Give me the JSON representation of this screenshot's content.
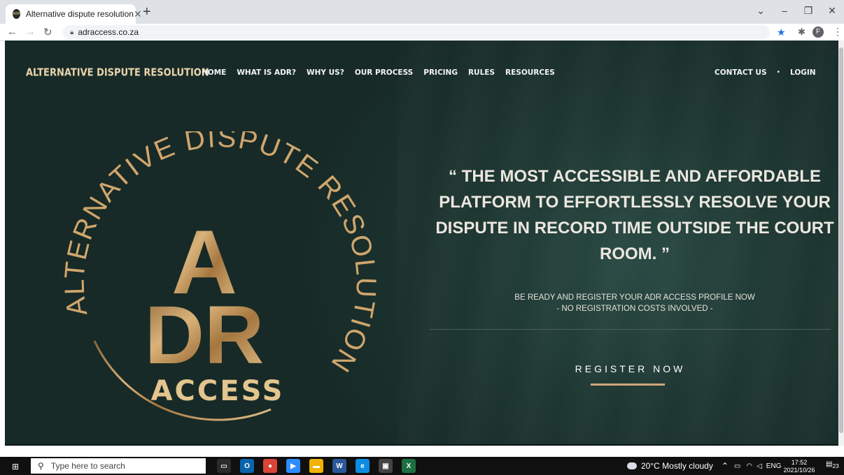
{
  "browser": {
    "tab_title": "Alternative dispute resolution",
    "tab_favicon": "ADR",
    "url": "adraccess.co.za",
    "profile_initial": "F",
    "window_controls": [
      "⌄",
      "–",
      "❐",
      "✕"
    ]
  },
  "site": {
    "brand": "ALTERNATIVE DISPUTE RESOLUTION",
    "nav_left": [
      "HOME",
      "WHAT IS ADR?",
      "WHY US?",
      "OUR PROCESS",
      "PRICING",
      "RULES",
      "RESOURCES"
    ],
    "nav_right": {
      "contact": "CONTACT US",
      "separator": "•",
      "login": "LOGIN"
    },
    "logo": {
      "ring_text": "ALTERNATIVE DISPUTE RESOLUTION",
      "letter_a": "A",
      "letters_dr": "DR",
      "access": "ACCESS"
    },
    "headline": "“ THE MOST ACCESSIBLE AND AFFORDABLE PLATFORM TO EFFORTLESSLY RESOLVE YOUR DISPUTE IN RECORD TIME OUTSIDE THE COURT ROOM. ”",
    "sub_line1": "BE READY AND REGISTER YOUR ADR ACCESS PROFILE NOW",
    "sub_line2": "- NO REGISTRATION COSTS INVOLVED -",
    "cta": "REGISTER NOW"
  },
  "taskbar": {
    "search_placeholder": "Type here to search",
    "weather": "20°C  Mostly cloudy",
    "language": "ENG",
    "time": "17:52",
    "date": "2021/10/26",
    "notifications": "23"
  },
  "colors": {
    "page_bg": "#1f3833",
    "gold": "#c89b63",
    "brand_text": "#e8d3ad",
    "accent_line": "#cfa77a"
  }
}
